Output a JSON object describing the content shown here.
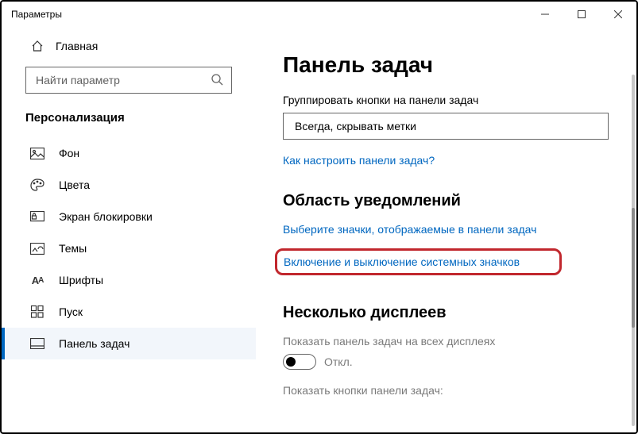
{
  "window": {
    "title": "Параметры"
  },
  "sidebar": {
    "home": "Главная",
    "search_placeholder": "Найти параметр",
    "section": "Персонализация",
    "items": [
      {
        "label": "Фон"
      },
      {
        "label": "Цвета"
      },
      {
        "label": "Экран блокировки"
      },
      {
        "label": "Темы"
      },
      {
        "label": "Шрифты"
      },
      {
        "label": "Пуск"
      },
      {
        "label": "Панель задач"
      }
    ]
  },
  "content": {
    "title": "Панель задач",
    "group_label": "Группировать кнопки на панели задач",
    "group_value": "Всегда, скрывать метки",
    "help_link": "Как настроить панели задач?",
    "section_notify": "Область уведомлений",
    "link_choose_icons": "Выберите значки, отображаемые в панели задач",
    "link_system_icons": "Включение и выключение системных значков",
    "section_multi": "Несколько дисплеев",
    "multi_label": "Показать панель задач на всех дисплеях",
    "toggle_off": "Откл.",
    "buttons_label": "Показать кнопки панели задач:"
  }
}
